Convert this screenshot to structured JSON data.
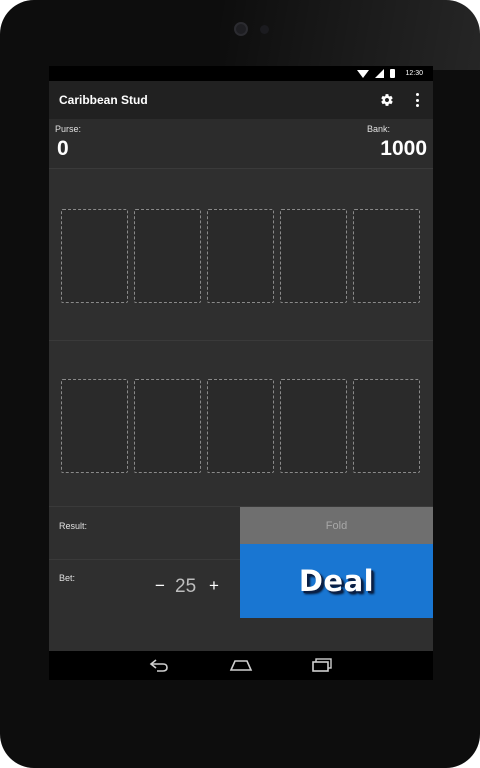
{
  "status_bar": {
    "time": "12:30",
    "icons": [
      "wifi-icon",
      "signal-icon",
      "battery-icon"
    ]
  },
  "app_bar": {
    "title": "Caribbean Stud",
    "actions": [
      "settings-icon",
      "overflow-menu-icon"
    ]
  },
  "purse": {
    "label": "Purse:",
    "value": "0"
  },
  "bank": {
    "label": "Bank:",
    "value": "1000"
  },
  "dealer_hand": {
    "card_slots": 5
  },
  "player_hand": {
    "card_slots": 5
  },
  "result": {
    "label": "Result:",
    "value": ""
  },
  "bet": {
    "label": "Bet:",
    "minus": "−",
    "value": "25",
    "plus": "+"
  },
  "buttons": {
    "fold": "Fold",
    "deal": "Deal"
  },
  "colors": {
    "deal_button": "#1976d2",
    "fold_button": "#6f6f6f",
    "app_bar": "#212121",
    "background": "#2f2f2f"
  },
  "nav_bar": {
    "icons": [
      "back-icon",
      "home-icon",
      "recents-icon"
    ]
  }
}
